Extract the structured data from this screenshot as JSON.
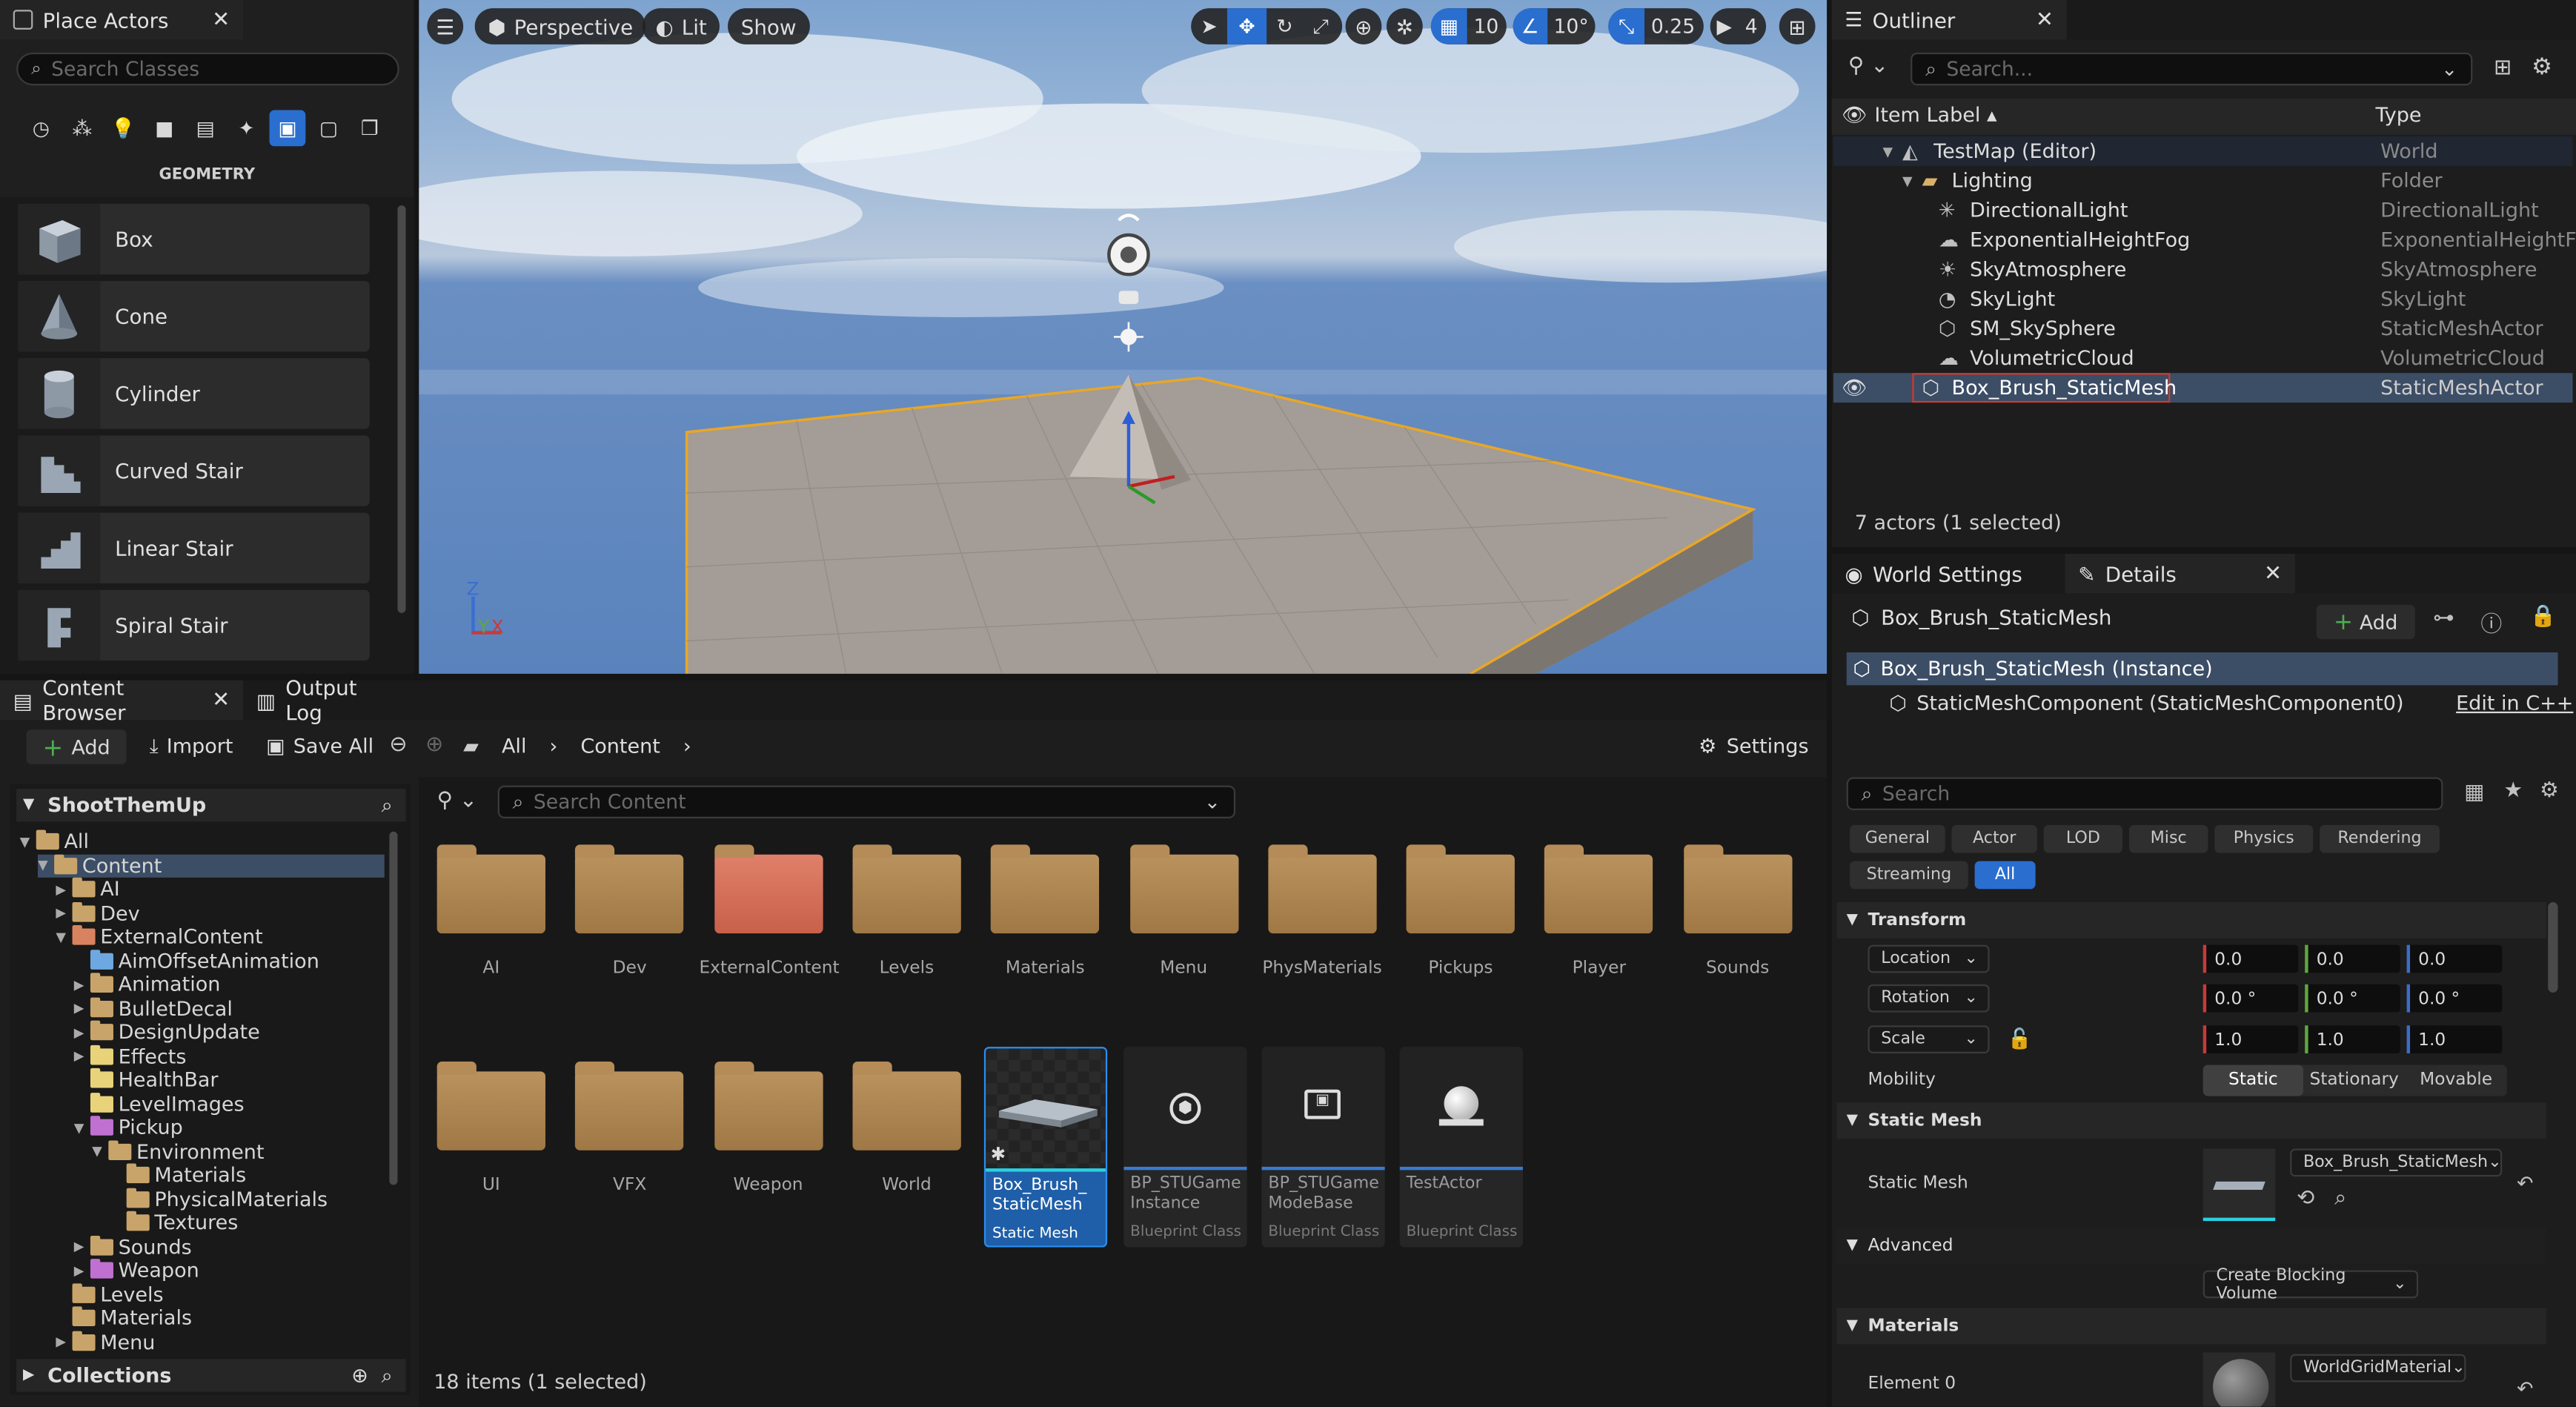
{
  "place_actors": {
    "title": "Place Actors",
    "search_placeholder": "Search Classes",
    "category": "GEOMETRY",
    "items": [
      "Box",
      "Cone",
      "Cylinder",
      "Curved Stair",
      "Linear Stair",
      "Spiral Stair"
    ]
  },
  "viewport": {
    "perspective": "Perspective",
    "lit": "Lit",
    "show": "Show",
    "grid": "10",
    "angle": "10°",
    "scale": "0.25",
    "camera": "4",
    "axis_z": "Z",
    "axis_y": "Y",
    "axis_x": "X"
  },
  "outliner": {
    "title": "Outliner",
    "search_placeholder": "Search...",
    "col_label": "Item Label",
    "col_type": "Type",
    "rows": [
      {
        "label": "TestMap (Editor)",
        "type": "World"
      },
      {
        "label": "Lighting",
        "type": "Folder"
      },
      {
        "label": "DirectionalLight",
        "type": "DirectionalLight"
      },
      {
        "label": "ExponentialHeightFog",
        "type": "ExponentialHeightFog"
      },
      {
        "label": "SkyAtmosphere",
        "type": "SkyAtmosphere"
      },
      {
        "label": "SkyLight",
        "type": "SkyLight"
      },
      {
        "label": "SM_SkySphere",
        "type": "StaticMeshActor"
      },
      {
        "label": "VolumetricCloud",
        "type": "VolumetricCloud"
      },
      {
        "label": "Box_Brush_StaticMesh",
        "type": "StaticMeshActor"
      }
    ],
    "status": "7 actors (1 selected)"
  },
  "details": {
    "tab_world": "World Settings",
    "tab_details": "Details",
    "actor_name": "Box_Brush_StaticMesh",
    "add": "Add",
    "instance": "Box_Brush_StaticMesh (Instance)",
    "component": "StaticMeshComponent (StaticMeshComponent0)",
    "edit_cpp": "Edit in C++",
    "search_placeholder": "Search",
    "filters": [
      "General",
      "Actor",
      "LOD",
      "Misc",
      "Physics",
      "Rendering",
      "Streaming",
      "All"
    ],
    "transform": "Transform",
    "location": "Location",
    "rotation": "Rotation",
    "scale": "Scale",
    "loc": [
      "0.0",
      "0.0",
      "0.0"
    ],
    "rot": [
      "0.0 °",
      "0.0 °",
      "0.0 °"
    ],
    "scl": [
      "1.0",
      "1.0",
      "1.0"
    ],
    "mobility": "Mobility",
    "mobility_opts": [
      "Static",
      "Stationary",
      "Movable"
    ],
    "static_mesh_sec": "Static Mesh",
    "static_mesh_label": "Static Mesh",
    "static_mesh_value": "Box_Brush_StaticMesh",
    "advanced": "Advanced",
    "create_blocking": "Create Blocking Volume",
    "materials": "Materials",
    "element0": "Element 0",
    "material_value": "WorldGridMaterial"
  },
  "content_browser": {
    "title": "Content Browser",
    "output_log": "Output Log",
    "add": "Add",
    "import": "Import",
    "save_all": "Save All",
    "crumb_all": "All",
    "crumb_content": "Content",
    "settings": "Settings",
    "project": "ShootThemUp",
    "search_placeholder": "Search Content",
    "tree": [
      {
        "label": "All",
        "depth": 0
      },
      {
        "label": "Content",
        "depth": 1
      },
      {
        "label": "AI",
        "depth": 2
      },
      {
        "label": "Dev",
        "depth": 2
      },
      {
        "label": "ExternalContent",
        "depth": 2
      },
      {
        "label": "AimOffsetAnimation",
        "depth": 3
      },
      {
        "label": "Animation",
        "depth": 3
      },
      {
        "label": "BulletDecal",
        "depth": 3
      },
      {
        "label": "DesignUpdate",
        "depth": 3
      },
      {
        "label": "Effects",
        "depth": 3
      },
      {
        "label": "HealthBar",
        "depth": 3
      },
      {
        "label": "LevelImages",
        "depth": 3
      },
      {
        "label": "Pickup",
        "depth": 3
      },
      {
        "label": "Environment",
        "depth": 4
      },
      {
        "label": "Materials",
        "depth": 5
      },
      {
        "label": "PhysicalMaterials",
        "depth": 5
      },
      {
        "label": "Textures",
        "depth": 5
      },
      {
        "label": "Sounds",
        "depth": 3
      },
      {
        "label": "Weapon",
        "depth": 3
      },
      {
        "label": "Levels",
        "depth": 2
      },
      {
        "label": "Materials",
        "depth": 2
      },
      {
        "label": "Menu",
        "depth": 2
      }
    ],
    "collections": "Collections",
    "folders": [
      "AI",
      "Dev",
      "ExternalContent",
      "Levels",
      "Materials",
      "Menu",
      "PhysMaterials",
      "Pickups",
      "Player",
      "Sounds",
      "UI",
      "VFX",
      "Weapon",
      "World"
    ],
    "assets": [
      {
        "name": "Box_Brush_StaticMesh",
        "line1": "Box_Brush_",
        "line2": "StaticMesh",
        "kind": "Static Mesh"
      },
      {
        "line1": "BP_STUGame",
        "line2": "Instance",
        "kind": "Blueprint Class"
      },
      {
        "line1": "BP_STUGame",
        "line2": "ModeBase",
        "kind": "Blueprint Class"
      },
      {
        "line1": "TestActor",
        "line2": "",
        "kind": "Blueprint Class"
      }
    ],
    "status": "18 items (1 selected)"
  }
}
